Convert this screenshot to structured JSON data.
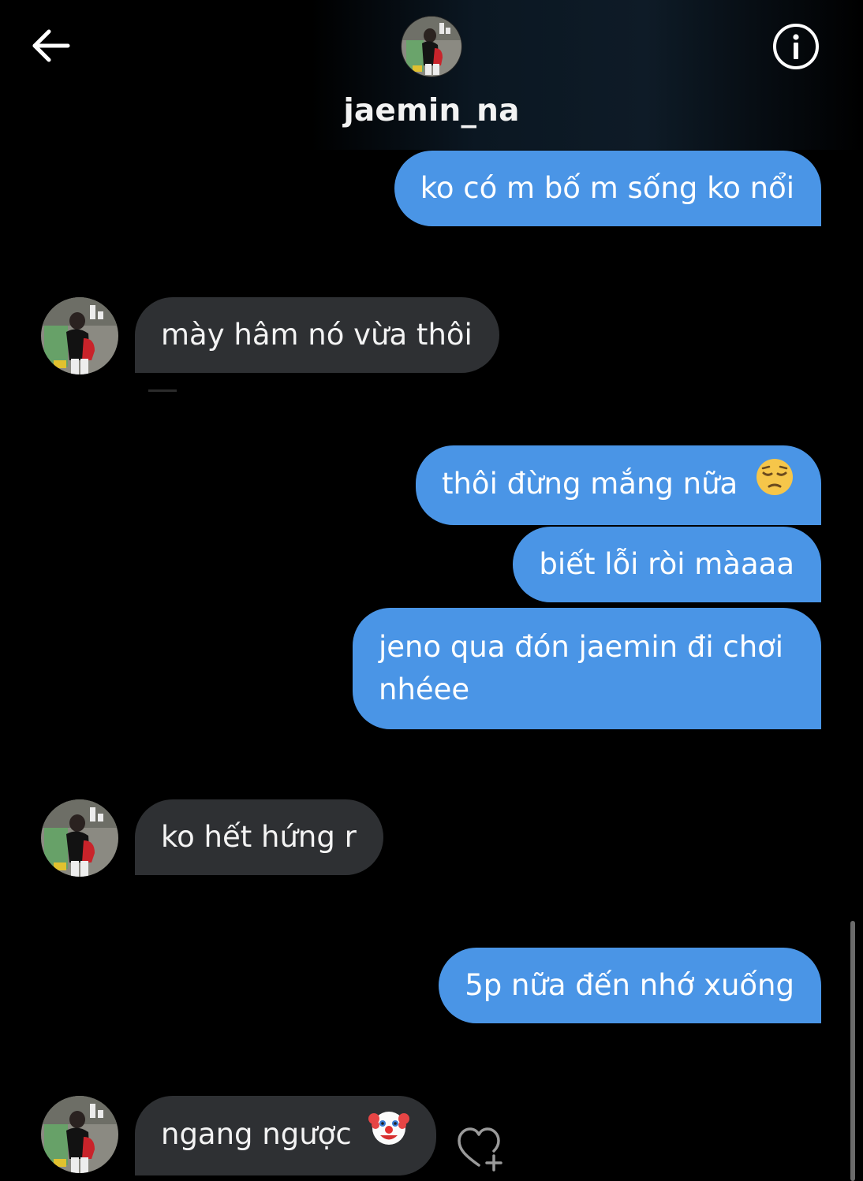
{
  "header": {
    "username": "jaemin_na",
    "back_icon": "arrow-left-icon",
    "info_icon": "info-circle-icon"
  },
  "colors": {
    "outgoing_bubble": "#4a95e6",
    "incoming_bubble": "#2e3033",
    "background": "#000000"
  },
  "messages": [
    {
      "direction": "out",
      "text": "ko có m bố m sống ko nổi"
    },
    {
      "direction": "in",
      "text": "mày hâm nó vừa thôi"
    },
    {
      "direction": "out",
      "text": "thôi đừng mắng nữa",
      "emoji": "pensive-face-emoji"
    },
    {
      "direction": "out",
      "text": "biết lỗi ròi màaaa"
    },
    {
      "direction": "out",
      "text": "jeno qua đón jaemin đi chơi nhéee"
    },
    {
      "direction": "in",
      "text": "ko hết hứng r"
    },
    {
      "direction": "out",
      "text": "5p nữa đến nhớ xuống"
    },
    {
      "direction": "in",
      "text": "ngang ngược",
      "emoji": "clown-face-emoji"
    }
  ],
  "like_icon": "heart-plus-icon"
}
